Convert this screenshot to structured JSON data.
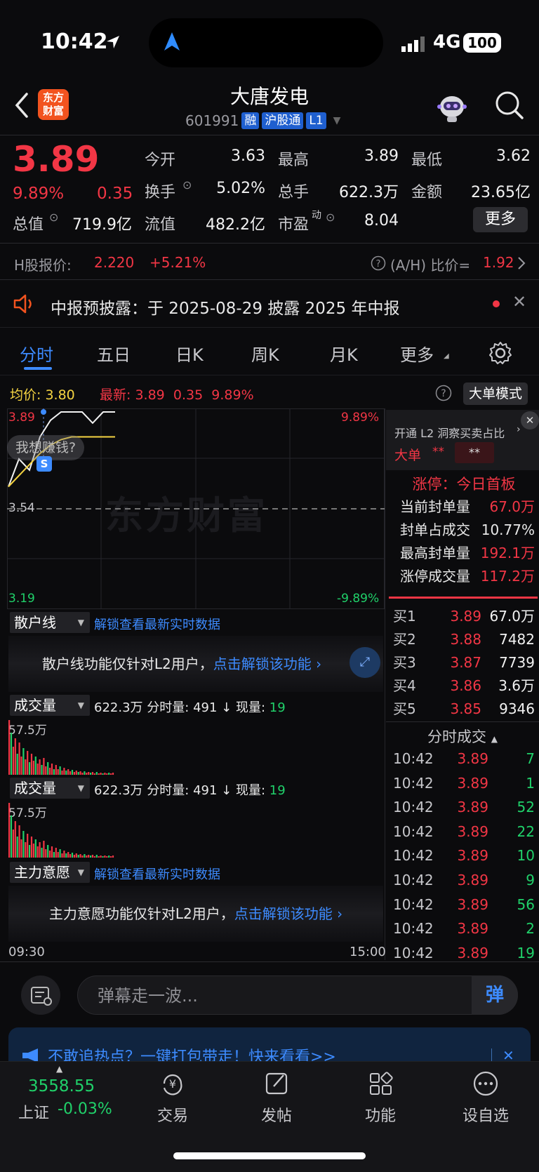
{
  "status": {
    "time": "10:42",
    "network": "4G",
    "battery": "100"
  },
  "header": {
    "logo_line1": "东方",
    "logo_line2": "财富",
    "stock_name": "大唐发电",
    "stock_code": "601991",
    "tags": [
      "融",
      "沪股通",
      "L1"
    ]
  },
  "quote": {
    "price": "3.89",
    "change_pct": "9.89%",
    "change": "0.35",
    "open_label": "今开",
    "open": "3.63",
    "high_label": "最高",
    "high": "3.89",
    "low_label": "最低",
    "low": "3.62",
    "turnover_label": "换手",
    "turnover": "5.02%",
    "volume_label": "总手",
    "volume": "622.3万",
    "amount_label": "金额",
    "amount": "23.65亿",
    "mktcap_label": "总值",
    "mktcap": "719.9亿",
    "float_label": "流值",
    "float": "482.2亿",
    "pe_label": "市盈",
    "pe_sup": "动",
    "pe": "8.04",
    "more_label": "更多"
  },
  "hshare": {
    "label": "H股报价:",
    "price": "2.220",
    "pct": "+5.21%",
    "ah_label": "(A/H) 比价=",
    "ah_value": "1.92"
  },
  "notice": {
    "text": "中报预披露：于 2025-08-29 披露 2025 年中报"
  },
  "tabs": [
    "分时",
    "五日",
    "日K",
    "周K",
    "月K",
    "更多"
  ],
  "chart": {
    "avg_label": "均价:",
    "avg": "3.80",
    "latest_label": "最新:",
    "latest": "3.89",
    "latest_chg": "0.35",
    "latest_pct": "9.89%",
    "big_order_label": "大单模式",
    "y_top": "3.89",
    "y_mid": "3.54",
    "y_bottom": "3.19",
    "pct_top": "9.89%",
    "pct_bottom": "-9.89%",
    "bubble": "我想赚钱?",
    "watermark": "东方财富",
    "time_start": "09:30",
    "time_end": "15:00",
    "chart_data": {
      "type": "line",
      "series": [
        {
          "values": [
            3.62,
            3.72,
            3.68,
            3.8,
            3.86,
            3.89,
            3.89,
            3.89,
            3.85,
            3.89,
            3.89
          ]
        },
        {
          "values": [
            3.62,
            3.66,
            3.7,
            3.74,
            3.77,
            3.79,
            3.8,
            3.8,
            3.8,
            3.8,
            3.8
          ]
        }
      ],
      "ylim": [
        3.19,
        3.89
      ]
    }
  },
  "retail": {
    "label": "散户线",
    "link": "解锁查看最新实时数据",
    "locked_text": "散户线功能仅针对L2用户，",
    "unlock": "点击解锁该功能"
  },
  "volume": {
    "label": "成交量",
    "total": "622.3万",
    "min_label": "分时量:",
    "min_val": "491",
    "now_label": "现量:",
    "now_val": "19",
    "max_label": "57.5万"
  },
  "main_force": {
    "label": "主力意愿",
    "link": "解锁查看最新实时数据",
    "locked_text": "主力意愿功能仅针对L2用户，",
    "unlock": "点击解锁该功能"
  },
  "right_panel": {
    "l2_title": "开通 L2 洞察买卖占比",
    "big_label": "大单",
    "big_val1": "**",
    "big_val2": "**",
    "limit_title": "涨停：今日首板",
    "seal_label": "当前封单量",
    "seal_val": "67.0万",
    "ratio_label": "封单占成交",
    "ratio_val": "10.77%",
    "max_seal_label": "最高封单量",
    "max_seal_val": "192.1万",
    "limit_vol_label": "涨停成交量",
    "limit_vol_val": "117.2万",
    "orderbook": [
      {
        "label": "买1",
        "price": "3.89",
        "vol": "67.0万"
      },
      {
        "label": "买2",
        "price": "3.88",
        "vol": "7482"
      },
      {
        "label": "买3",
        "price": "3.87",
        "vol": "7739"
      },
      {
        "label": "买4",
        "price": "3.86",
        "vol": "3.6万"
      },
      {
        "label": "买5",
        "price": "3.85",
        "vol": "9346"
      }
    ],
    "trades_title": "分时成交",
    "trades": [
      {
        "t": "10:42",
        "p": "3.89",
        "v": "7"
      },
      {
        "t": "10:42",
        "p": "3.89",
        "v": "1"
      },
      {
        "t": "10:42",
        "p": "3.89",
        "v": "52"
      },
      {
        "t": "10:42",
        "p": "3.89",
        "v": "22"
      },
      {
        "t": "10:42",
        "p": "3.89",
        "v": "10"
      },
      {
        "t": "10:42",
        "p": "3.89",
        "v": "9"
      },
      {
        "t": "10:42",
        "p": "3.89",
        "v": "56"
      },
      {
        "t": "10:42",
        "p": "3.89",
        "v": "2"
      },
      {
        "t": "10:42",
        "p": "3.89",
        "v": "19"
      }
    ]
  },
  "danmu": {
    "placeholder": "弹幕走一波...",
    "button": "弹"
  },
  "banner": {
    "text": "不敢追热点？一键打包带走！快来看看>>"
  },
  "bottom": {
    "index_value": "3558.55",
    "index_name": "上证",
    "index_pct": "-0.03%",
    "nav": [
      "交易",
      "发帖",
      "功能",
      "设自选"
    ]
  },
  "colors": {
    "up": "#f23645",
    "down": "#20d16a",
    "accent": "#3d8bff",
    "avg": "#f5d442"
  }
}
